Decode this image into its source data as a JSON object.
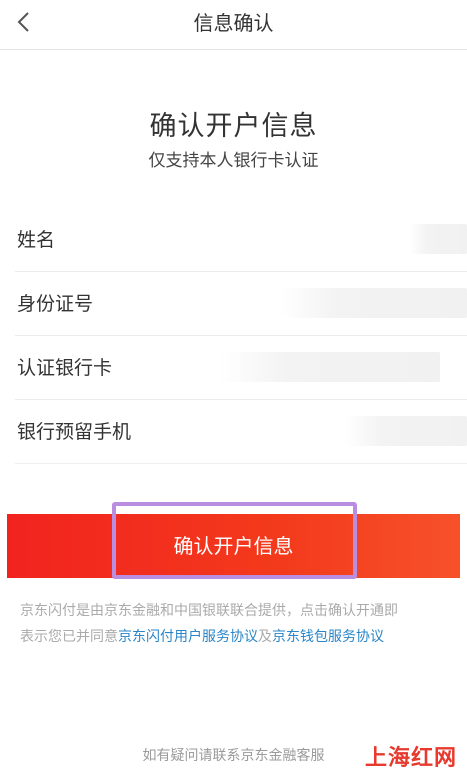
{
  "nav": {
    "title": "信息确认",
    "back_icon": "chevron-left-icon"
  },
  "header": {
    "title": "确认开户信息",
    "subtitle": "仅支持本人银行卡认证"
  },
  "form": {
    "fields": [
      {
        "label": "姓名",
        "value": ""
      },
      {
        "label": "身份证号",
        "value": ""
      },
      {
        "label": "认证银行卡",
        "value": ""
      },
      {
        "label": "银行预留手机",
        "value": ""
      }
    ]
  },
  "confirm_button": {
    "label": "确认开户信息"
  },
  "notice": {
    "line1": "京东闪付是由京东金融和中国银联联合提供，点击确认开通即",
    "line2_prefix": "表示您已并同意",
    "link1": "京东闪付用户服务协议",
    "joiner": "及",
    "link2": "京东钱包服务协议"
  },
  "footer": {
    "contact": "如有疑问请联系京东金融客服"
  },
  "watermark": {
    "text": "上海红网"
  },
  "colors": {
    "accent": "#f2231f",
    "link": "#2a86c8",
    "highlight_border": "#b98ee0"
  }
}
